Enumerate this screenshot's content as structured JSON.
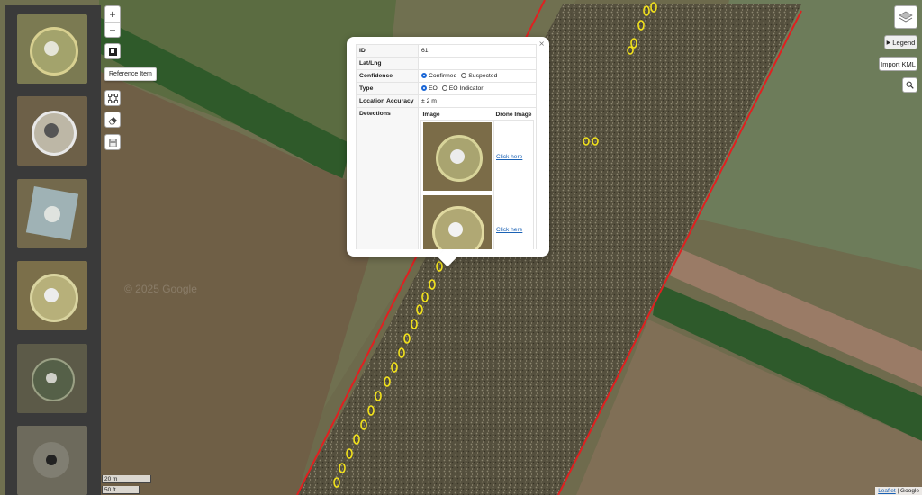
{
  "map": {
    "watermark": "© 2025 Google",
    "attribution": {
      "leaflet": "Leaflet",
      "separator": " | ",
      "provider": "Google"
    },
    "scale": {
      "metric": "20 m",
      "imperial": "50 ft"
    }
  },
  "controls": {
    "zoom_in": "+",
    "zoom_out": "−",
    "reference_tooltip": "Reference Item",
    "legend": "Legend",
    "import_kml": "Import KML"
  },
  "icons": {
    "zoom_in": "plus-icon",
    "zoom_out": "minus-icon",
    "reference": "square-icon",
    "draw": "polygon-icon",
    "erase": "eraser-icon",
    "save": "floppy-icon",
    "layers": "layers-icon",
    "legend": "triangle-right-icon",
    "search": "magnifier-icon"
  },
  "popup": {
    "close": "×",
    "rows": {
      "id": {
        "label": "ID",
        "value": "61"
      },
      "latlng": {
        "label": "Lat/Lng",
        "value": ""
      },
      "confidence": {
        "label": "Confidence",
        "options": [
          "Confirmed",
          "Suspected"
        ],
        "selected": "Confirmed"
      },
      "type": {
        "label": "Type",
        "options": [
          "EO",
          "EO Indicator"
        ],
        "selected": "EO"
      },
      "accuracy": {
        "label": "Location Accuracy",
        "value": "± 2 m"
      }
    },
    "detections": {
      "label": "Detections",
      "headers": [
        "Image",
        "Drone Image"
      ],
      "items": [
        {
          "link": "Click here"
        },
        {
          "link": "Click here"
        }
      ]
    }
  },
  "colors": {
    "boundary": "#e02020",
    "detection": "#f2e21c",
    "sidebar": "#3a3a3a",
    "link": "#1b62b5"
  }
}
